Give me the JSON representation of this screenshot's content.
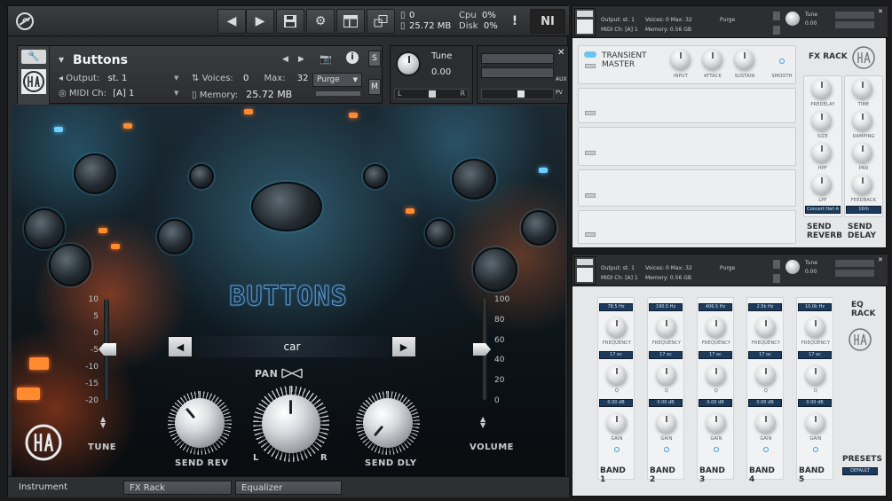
{
  "topbar": {
    "value_top": "0",
    "memory": "25.72 MB",
    "cpu_label": "Cpu",
    "cpu_value": "0%",
    "disk_label": "Disk",
    "disk_value": "0%",
    "ni_logo": "NI"
  },
  "instrument": {
    "title": "Buttons",
    "output_label": "Output:",
    "output_value": "st. 1",
    "voices_label": "Voices:",
    "voices_value": "0",
    "max_label": "Max:",
    "max_value": "32",
    "purge": "Purge",
    "midi_label": "MIDI Ch:",
    "midi_value": "[A] 1",
    "memory_label": "Memory:",
    "memory_value": "25.72 MB",
    "s_btn": "S",
    "m_btn": "M",
    "tune_label": "Tune",
    "tune_value": "0.00",
    "pan_l": "L",
    "pan_r": "R",
    "aux": "AUX",
    "pv": "PV"
  },
  "main": {
    "buttons_title": "BUTTONS",
    "selected_preset": "car",
    "pan_label": "PAN",
    "pan_l": "L",
    "pan_r": "R",
    "send_rev": "SEND REV",
    "send_dly": "SEND DLY",
    "tune": "TUNE",
    "volume": "VOLUME",
    "tune_scale": [
      "10",
      "5",
      "0",
      "-5",
      "-10",
      "-15",
      "-20"
    ],
    "volume_scale": [
      "100",
      "80",
      "60",
      "40",
      "20",
      "0"
    ],
    "tune_level": 0.5,
    "volume_level": 0.5
  },
  "tabs": {
    "instrument": "Instrument",
    "fx_rack": "FX Rack",
    "equalizer": "Equalizer"
  },
  "fx_panel": {
    "header": {
      "output_label": "Output:",
      "output_value": "st. 1",
      "voices_label": "Voices:",
      "voices_value": "0",
      "max_label": "Max:",
      "max_value": "32",
      "purge": "Purge",
      "midi_label": "MIDI Ch:",
      "midi_value": "[A] 1",
      "memory_label": "Memory:",
      "memory_value": "0.56 GB",
      "tune_label": "Tune",
      "tune_value": "0.00"
    },
    "transient_title_1": "TRANSIENT",
    "transient_title_2": "MASTER",
    "transient_knobs": [
      "INPUT",
      "ATTACK",
      "SUSTAIN"
    ],
    "smooth": "SMOOTH",
    "fx_rack": "FX RACK",
    "reverb_knobs": [
      "PREDELAY",
      "SIZE",
      "HPF",
      "LPF"
    ],
    "delay_knobs": [
      "TIME",
      "DAMPING",
      "PAN",
      "FEEDBACK"
    ],
    "reverb_preset": "Concert Hall A",
    "delay_preset": "16th",
    "send_reverb_1": "SEND",
    "send_reverb_2": "REVERB",
    "send_delay_1": "SEND",
    "send_delay_2": "DELAY"
  },
  "eq_panel": {
    "header": {
      "output_label": "Output:",
      "output_value": "st. 1",
      "voices_label": "Voices:",
      "voices_value": "0",
      "max_label": "Max:",
      "max_value": "32",
      "purge": "Purge",
      "midi_label": "MIDI Ch:",
      "midi_value": "[A] 1",
      "memory_label": "Memory:",
      "memory_value": "0.56 GB",
      "tune_label": "Tune",
      "tune_value": "0.00"
    },
    "eq_title_1": "EQ",
    "eq_title_2": "RACK",
    "presets": "PRESETS",
    "default": "DEFAULT",
    "frequency": "FREQUENCY",
    "q": "Q",
    "gain": "GAIN",
    "bands": [
      {
        "name": "BAND 1",
        "freq": "78.5 Hz",
        "q": "17 oc",
        "gain": "0.00 dB"
      },
      {
        "name": "BAND 2",
        "freq": "190.5 Hz",
        "q": "17 oc",
        "gain": "0.00 dB"
      },
      {
        "name": "BAND 3",
        "freq": "406.5 Hz",
        "q": "17 oc",
        "gain": "0.00 dB"
      },
      {
        "name": "BAND 4",
        "freq": "2.5k Hz",
        "q": "17 oc",
        "gain": "0.00 dB"
      },
      {
        "name": "BAND 5",
        "freq": "10.0k Hz",
        "q": "17 oc",
        "gain": "0.00 dB"
      }
    ]
  }
}
